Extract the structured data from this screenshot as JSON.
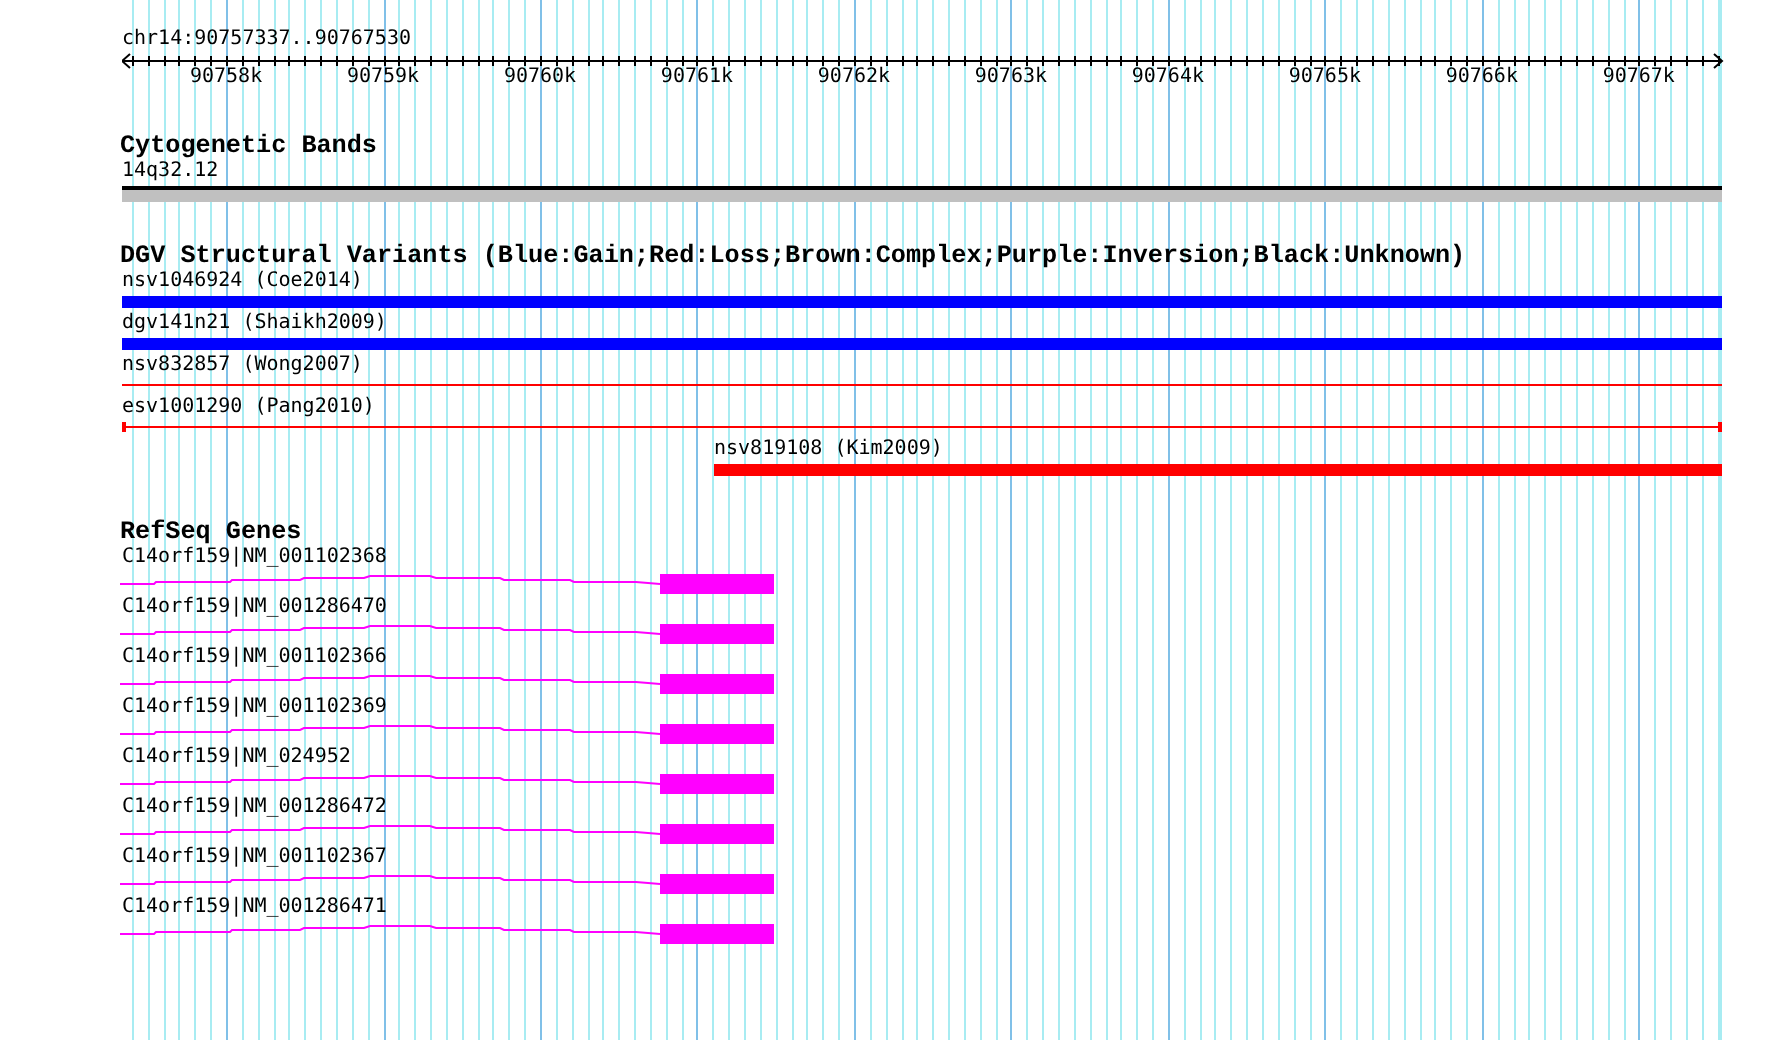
{
  "ruler": {
    "region": "chr14:90757337..90767530",
    "tick_labels": [
      "90758k",
      "90759k",
      "90760k",
      "90761k",
      "90762k",
      "90763k",
      "90764k",
      "90765k",
      "90766k",
      "90767k"
    ]
  },
  "cytogenetic_bands": {
    "title": "Cytogenetic Bands",
    "band": "14q32.12"
  },
  "dgv_variants": {
    "title": "DGV Structural Variants (Blue:Gain;Red:Loss;Brown:Complex;Purple:Inversion;Black:Unknown)",
    "items": [
      {
        "label": "nsv1046924 (Coe2014)",
        "color": "#0000ff",
        "kind": "bar"
      },
      {
        "label": "dgv141n21 (Shaikh2009)",
        "color": "#0000ff",
        "kind": "bar"
      },
      {
        "label": "nsv832857 (Wong2007)",
        "color": "#ff0000",
        "kind": "line"
      },
      {
        "label": "esv1001290 (Pang2010)",
        "color": "#ff0000",
        "kind": "capped"
      },
      {
        "label": "nsv819108 (Kim2009)",
        "color": "#ff0000",
        "kind": "bar"
      }
    ]
  },
  "refseq_genes": {
    "title": "RefSeq Genes",
    "items": [
      {
        "label": "C14orf159|NM_001102368"
      },
      {
        "label": "C14orf159|NM_001286470"
      },
      {
        "label": "C14orf159|NM_001102366"
      },
      {
        "label": "C14orf159|NM_001102369"
      },
      {
        "label": "C14orf159|NM_024952"
      },
      {
        "label": "C14orf159|NM_001286472"
      },
      {
        "label": "C14orf159|NM_001102367"
      },
      {
        "label": "C14orf159|NM_001286471"
      }
    ]
  }
}
